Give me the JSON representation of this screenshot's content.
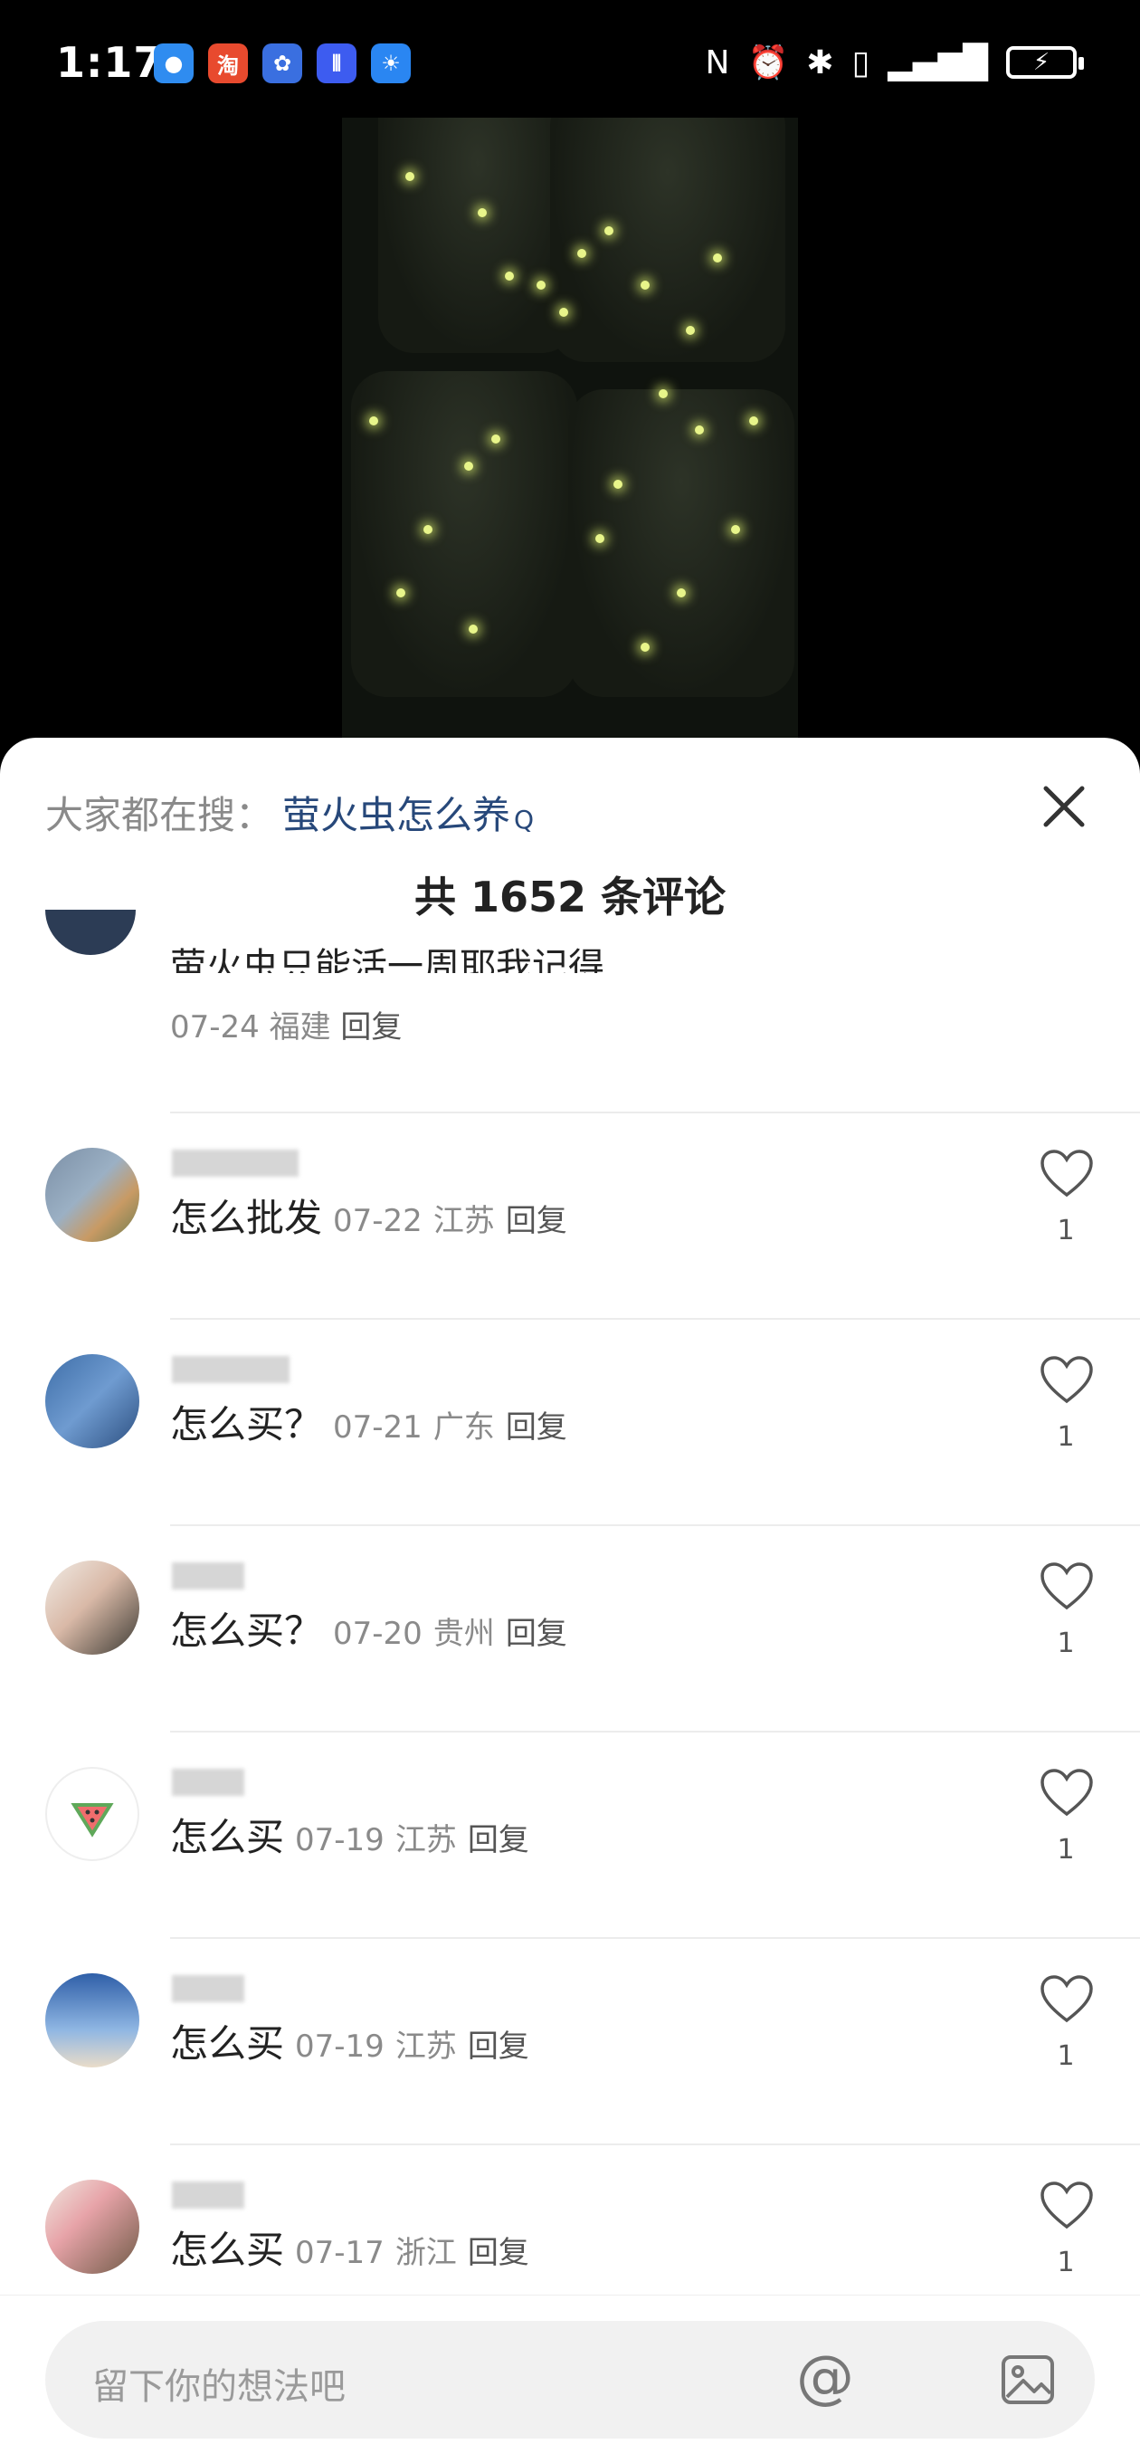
{
  "status_bar": {
    "time": "1:17",
    "app_icons": [
      "chat-app-icon",
      "taobao-app-icon",
      "baidu-app-icon",
      "voice-app-icon",
      "bulb-app-icon"
    ]
  },
  "search": {
    "prefix": "大家都在搜：",
    "term": "萤火虫怎么养",
    "icon": "search-q-icon"
  },
  "comment_count_label": "共 1652 条评论",
  "partial_comment": {
    "text": "萤火虫只能活一周耶我记得",
    "date": "07-24",
    "location": "福建",
    "reply": "回复"
  },
  "comments": [
    {
      "text": "怎么批发",
      "date": "07-22",
      "location": "江苏",
      "reply": "回复",
      "likes": "1"
    },
    {
      "text": "怎么买？",
      "date": "07-21",
      "location": "广东",
      "reply": "回复",
      "likes": "1"
    },
    {
      "text": "怎么买？",
      "date": "07-20",
      "location": "贵州",
      "reply": "回复",
      "likes": "1"
    },
    {
      "text": "怎么买",
      "date": "07-19",
      "location": "江苏",
      "reply": "回复",
      "likes": "1"
    },
    {
      "text": "怎么买",
      "date": "07-19",
      "location": "江苏",
      "reply": "回复",
      "likes": "1"
    },
    {
      "text": "怎么买",
      "date": "07-17",
      "location": "浙江",
      "reply": "回复",
      "likes": "1"
    }
  ],
  "input": {
    "placeholder": "留下你的想法吧"
  },
  "colors": {
    "search_term": "#27487a",
    "meta": "#8a8a8a"
  }
}
